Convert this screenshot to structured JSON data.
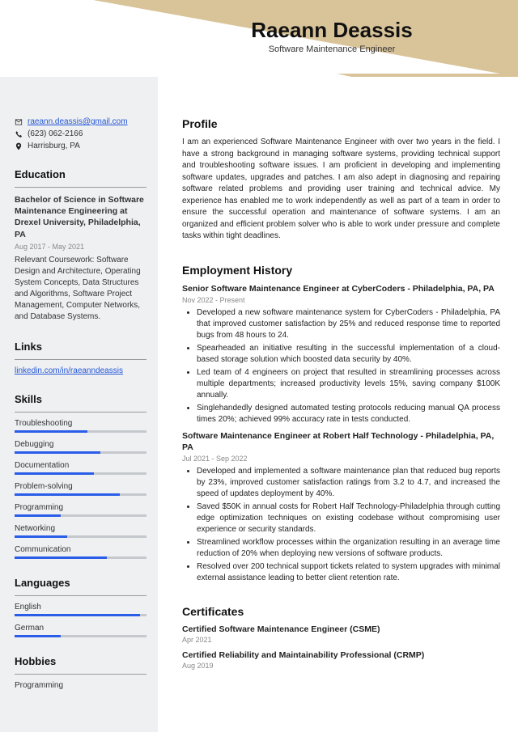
{
  "header": {
    "name": "Raeann Deassis",
    "title": "Software Maintenance Engineer"
  },
  "contact": {
    "email": "raeann.deassis@gmail.com",
    "phone": "(623) 062-2166",
    "location": "Harrisburg, PA"
  },
  "education": {
    "heading": "Education",
    "degree": "Bachelor of Science in Software Maintenance Engineering at Drexel University, Philadelphia, PA",
    "dates": "Aug 2017 - May 2021",
    "body": "Relevant Coursework: Software Design and Architecture, Operating System Concepts, Data Structures and Algorithms, Software Project Management, Computer Networks, and Database Systems."
  },
  "links": {
    "heading": "Links",
    "items": [
      "linkedin.com/in/raeanndeassis"
    ]
  },
  "skills": {
    "heading": "Skills",
    "items": [
      {
        "label": "Troubleshooting",
        "pct": 55
      },
      {
        "label": "Debugging",
        "pct": 65
      },
      {
        "label": "Documentation",
        "pct": 60
      },
      {
        "label": "Problem-solving",
        "pct": 80
      },
      {
        "label": "Programming",
        "pct": 35
      },
      {
        "label": "Networking",
        "pct": 40
      },
      {
        "label": "Communication",
        "pct": 70
      }
    ]
  },
  "languages": {
    "heading": "Languages",
    "items": [
      {
        "label": "English",
        "pct": 95
      },
      {
        "label": "German",
        "pct": 35
      }
    ]
  },
  "hobbies": {
    "heading": "Hobbies",
    "items": [
      "Programming"
    ]
  },
  "profile": {
    "heading": "Profile",
    "body": "I am an experienced Software Maintenance Engineer with over two years in the field. I have a strong background in managing software systems, providing technical support and troubleshooting software issues. I am proficient in developing and implementing software updates, upgrades and patches. I am also adept in diagnosing and repairing software related problems and providing user training and technical advice. My experience has enabled me to work independently as well as part of a team in order to ensure the successful operation and maintenance of software systems. I am an organized and efficient problem solver who is able to work under pressure and complete tasks within tight deadlines."
  },
  "employment": {
    "heading": "Employment History",
    "jobs": [
      {
        "title": "Senior Software Maintenance Engineer at CyberCoders - Philadelphia, PA, PA",
        "dates": "Nov 2022 - Present",
        "bullets": [
          "Developed a new software maintenance system for CyberCoders - Philadelphia, PA that improved customer satisfaction by 25% and reduced response time to reported bugs from 48 hours to 24.",
          "Spearheaded an initiative resulting in the successful implementation of a cloud-based storage solution which boosted data security by 40%.",
          "Led team of 4 engineers on project that resulted in streamlining processes across multiple departments; increased productivity levels 15%, saving company $100K annually.",
          "Singlehandedly designed automated testing protocols reducing manual QA process times 20%; achieved 99% accuracy rate in tests conducted."
        ]
      },
      {
        "title": "Software Maintenance Engineer at Robert Half Technology - Philadelphia, PA, PA",
        "dates": "Jul 2021 - Sep 2022",
        "bullets": [
          "Developed and implemented a software maintenance plan that reduced bug reports by 23%, improved customer satisfaction ratings from 3.2 to 4.7, and increased the speed of updates deployment by 40%.",
          "Saved $50K in annual costs for Robert Half Technology-Philadelphia through cutting edge optimization techniques on existing codebase without compromising user experience or security standards.",
          "Streamlined workflow processes within the organization resulting in an average time reduction of 20% when deploying new versions of software products.",
          "Resolved over 200 technical support tickets related to system upgrades with minimal external assistance leading to better client retention rate."
        ]
      }
    ]
  },
  "certificates": {
    "heading": "Certificates",
    "items": [
      {
        "title": "Certified Software Maintenance Engineer (CSME)",
        "date": "Apr 2021"
      },
      {
        "title": "Certified Reliability and Maintainability Professional (CRMP)",
        "date": "Aug 2019"
      }
    ]
  }
}
